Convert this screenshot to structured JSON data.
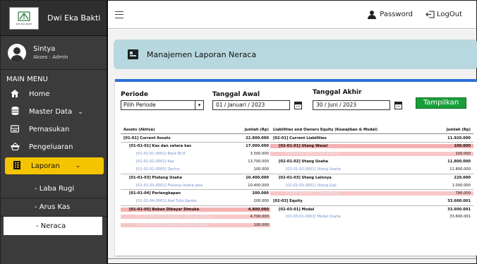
{
  "brand": {
    "name": "Dwi Eka Bakti",
    "logo_text": "DWI EKA BAKTI"
  },
  "user": {
    "name": "Sintya",
    "role": "Akses : Admin"
  },
  "menu_label": "MAIN MENU",
  "nav": [
    {
      "label": "Home"
    },
    {
      "label": "Master Data"
    },
    {
      "label": "Pemasukan"
    },
    {
      "label": "Pengeluaran"
    },
    {
      "label": "Laporan"
    }
  ],
  "subnav": [
    {
      "label": "- Laba Rugi"
    },
    {
      "label": "- Arus Kas"
    },
    {
      "label": "- Neraca"
    }
  ],
  "topbar": {
    "password_label": "Password",
    "logout_label": "LogOut"
  },
  "page": {
    "title": "Manajemen Laporan Neraca"
  },
  "filters": {
    "periode_label": "Periode",
    "periode_value": "Pilih Periode",
    "tgl_awal_label": "Tanggal Awal",
    "tgl_awal_value": "01 / Januari / 2023",
    "tgl_akhir_label": "Tanggal Akhir",
    "tgl_akhir_value": "30 / Juni / 2023",
    "show_button": "Tampilkan"
  },
  "report": {
    "headers": {
      "left_name": "Assets (Aktiva)",
      "left_amount": "Jumlah (Rp)",
      "right_name": "Liabilities and Owners Equity (Kewajiban & Modal)",
      "right_amount": "Jumlah (Rp)"
    },
    "rows": [
      {
        "l": "[01-01] Current Assets",
        "la": "22.800.000",
        "r": "[02-01] Current Liabilities",
        "ra": "11.920.000"
      },
      {
        "l": "[01-01-01] Kas dan setara kas",
        "la": "17.000.000",
        "r": "[02-01-01] Utang Wesel",
        "ra": "100.000"
      },
      {
        "l": "[01-01-01-0001] Bank BCA",
        "la": "3.300.000",
        "r": "[02-01-01-0001] Utang Wesel",
        "ra": "100.000"
      },
      {
        "l": "[01-01-01-0002] Kas",
        "la": "13.700.000",
        "r": "[02-01-02] Utang Usaha",
        "ra": "11.800.000"
      },
      {
        "l": "[01-01-01-0005] Zectra",
        "la": "100.000",
        "r": "[02-01-02-0001] Utang Usaha",
        "ra": "11.800.000"
      },
      {
        "l": "[01-01-03] Piutang Usaha",
        "la": "10.400.000",
        "r": "[02-01-03] Utang Lainnya",
        "ra": "220.000"
      },
      {
        "l": "[01-01-03-0001] Piutang Usaha Jasa",
        "la": "10.400.000",
        "r": "[02-01-03-0001] Utang Gaji",
        "ra": "1.000.000"
      },
      {
        "l": "[01-01-04] Perlengkapan",
        "la": "200.000",
        "r": "[02-01-03-0002] Utang Bunga",
        "ra": "780.000"
      },
      {
        "l": "[01-01-04-0001] Alat Tulis Kantor",
        "la": "200.000",
        "r": "[02-03] Equity",
        "ra": "33.600.001"
      },
      {
        "l": "[01-01-05] Beban Dibayar Dimuka",
        "la": "4.800.000",
        "r": "[02-03-01] Modal",
        "ra": "33.600.001"
      },
      {
        "l": "[01-01-05-0001] Asuransi Dibayar Dimuka",
        "la": "4.700.000",
        "r": "[02-03-01-0001] Modal Usaha",
        "ra": "33.600.001"
      },
      {
        "l": "[01-01-05-0003] Sewa Dibayar Dimuka",
        "la": "100.000",
        "r": "",
        "ra": ""
      }
    ]
  },
  "colors": {
    "sidebar": "#3b3b3b",
    "active_nav": "#f5c400",
    "header_bg": "#b7d8de",
    "card_top": "#2e6fd8",
    "button": "#1a9e3a",
    "highlight_row": "#f5b2b2"
  }
}
